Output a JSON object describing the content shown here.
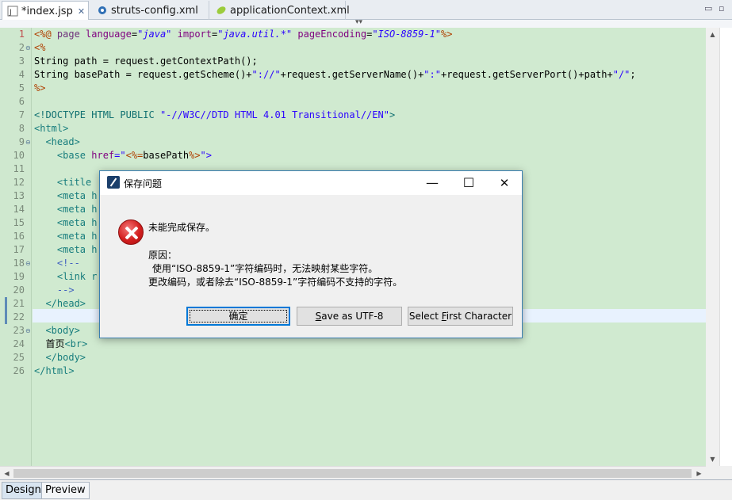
{
  "tabs": [
    {
      "label": "*index.jsp",
      "icon": "jsp-file-icon",
      "close": "✕"
    },
    {
      "label": "struts-config.xml",
      "icon": "gear-file-icon"
    },
    {
      "label": "applicationContext.xml",
      "icon": "spring-leaf-icon"
    }
  ],
  "lines": [
    "1",
    "2",
    "3",
    "4",
    "5",
    "6",
    "7",
    "8",
    "9",
    "10",
    "11",
    "12",
    "13",
    "14",
    "15",
    "16",
    "17",
    "18",
    "19",
    "20",
    "21",
    "22",
    "23",
    "24",
    "25",
    "26"
  ],
  "code": {
    "l1": {
      "a": "<%@ ",
      "b": "page ",
      "c": "language",
      "d": "=",
      "e": "\"java\"",
      "f": " import",
      "g": "=",
      "h": "\"java.util.*\"",
      "i": " pageEncoding",
      "j": "=",
      "k": "\"ISO-8859-1\"",
      "l": "%>"
    },
    "l2": "<%",
    "l3": "String path = request.getContextPath();",
    "l4a": "String basePath = request.getScheme()+",
    "l4b": "\"://\"",
    "l4c": "+request.getServerName()+",
    "l4d": "\":\"",
    "l4e": "+request.getServerPort()+path+",
    "l4f": "\"/\"",
    "l4g": ";",
    "l5": "%>",
    "l7a": "<!DOCTYPE HTML PUBLIC ",
    "l7b": "\"-//W3C//DTD HTML 4.01 Transitional//EN\"",
    "l7c": ">",
    "l8": "<html>",
    "l9": "  <head>",
    "l10a": "    <base ",
    "l10b": "href",
    "l10c": "=\"",
    "l10d": "<%=",
    "l10e": "basePath",
    "l10f": "%>",
    "l10g": "\">",
    "l12": "    <title",
    "l13": "    <meta h",
    "l14": "    <meta h",
    "l15": "    <meta h",
    "l16": "    <meta h",
    "l17": "    <meta h",
    "l18": "    <!--",
    "l19": "    <link r",
    "l20": "    -->",
    "l21": "  </head>",
    "l23": "  <body>",
    "l24a": "  首页",
    "l24b": "<br>",
    "l25": "  </body>",
    "l26": "</html>"
  },
  "dialog": {
    "title": "保存问题",
    "minimize": "—",
    "maximize": "☐",
    "close": "✕",
    "message": "未能完成保存。",
    "reason_label": "原因：",
    "reason_line1": "使用“ISO-8859-1”字符编码时，无法映射某些字符。",
    "reason_line2": "更改编码，或者除去“ISO-8859-1”字符编码不支持的字符。",
    "buttons": {
      "ok": "确定",
      "save_utf8_pre": "S",
      "save_utf8_rest": "ave as UTF-8",
      "select_first_pre": "Select ",
      "select_first_u": "F",
      "select_first_rest": "irst Character"
    }
  },
  "bottom_tabs": [
    "Design",
    "Preview"
  ],
  "window_controls": {
    "minimize": "▭",
    "maximize": "▫"
  }
}
